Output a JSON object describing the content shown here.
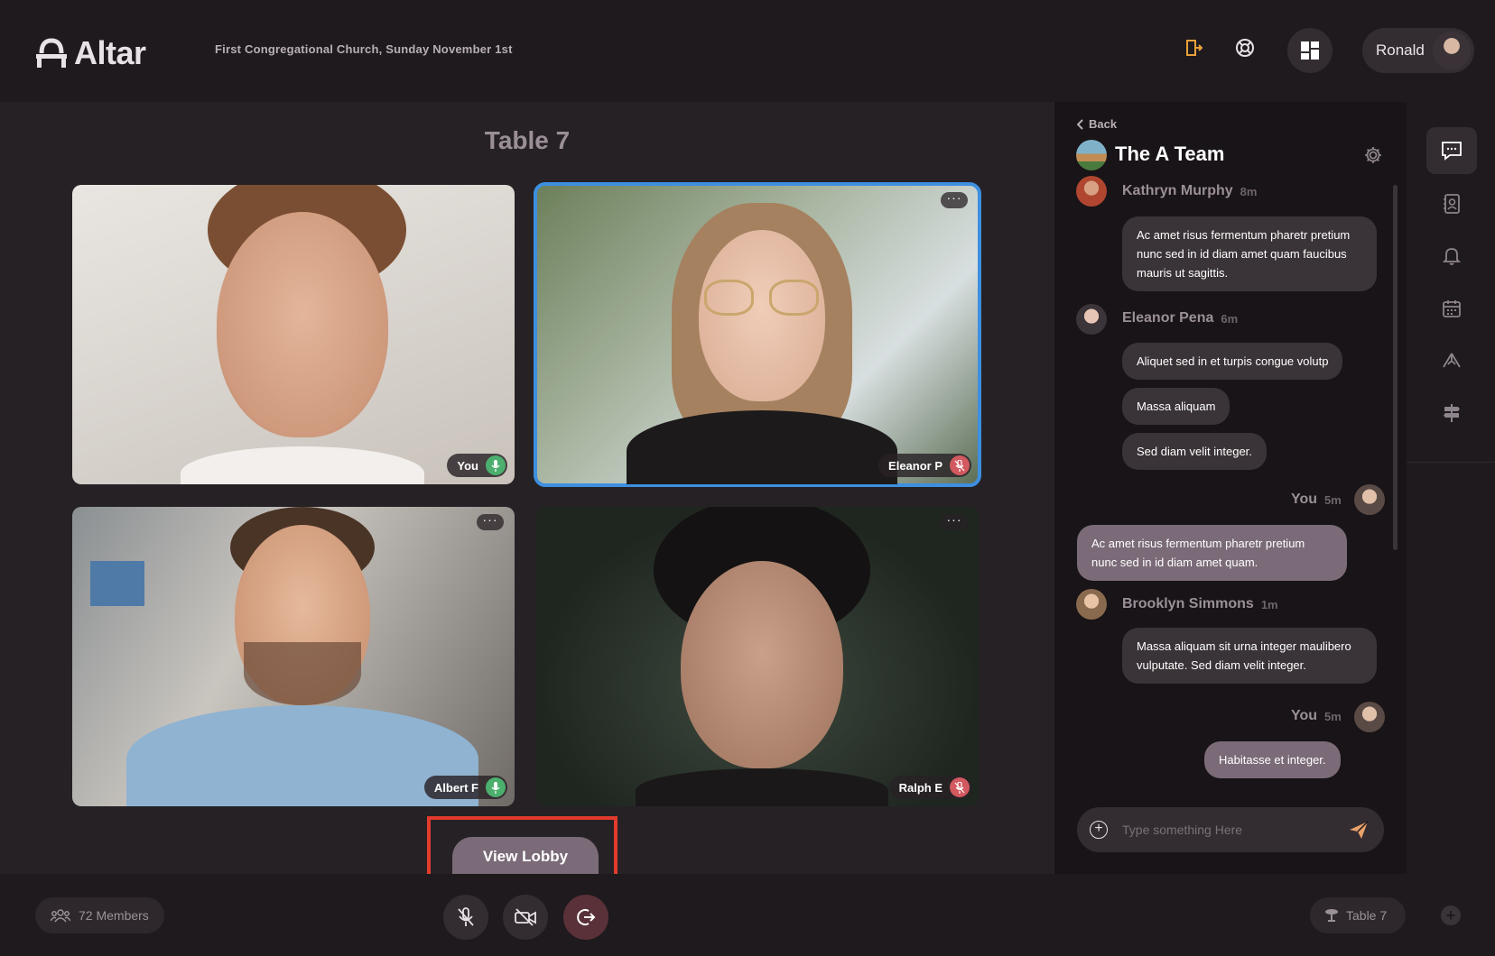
{
  "app": {
    "name": "Altar",
    "event_title": "First Congregational Church, Sunday November 1st"
  },
  "header": {
    "user_name": "Ronald",
    "icons": [
      "exit-door-icon",
      "lifebuoy-icon",
      "grid-layout-icon"
    ]
  },
  "stage": {
    "title": "Table 7",
    "participants": [
      {
        "name": "You",
        "mic": "on"
      },
      {
        "name": "Eleanor P",
        "mic": "off",
        "active": true
      },
      {
        "name": "Albert F",
        "mic": "on"
      },
      {
        "name": "Ralph E",
        "mic": "off"
      }
    ],
    "lobby_button": "View Lobby"
  },
  "chat": {
    "back_label": "Back",
    "team_name": "The A Team",
    "messages": [
      {
        "author": "Kathryn Murphy",
        "time": "8m",
        "texts": [
          "Ac amet risus fermentum pharetr pretium nunc sed in id diam amet quam faucibus mauris ut sagittis."
        ]
      },
      {
        "author": "Eleanor Pena",
        "time": "6m",
        "texts": [
          "Aliquet sed in et turpis congue volutp",
          "Massa aliquam",
          "Sed diam velit integer."
        ]
      },
      {
        "author": "You",
        "time": "5m",
        "texts": [
          "Ac amet risus fermentum pharetr pretium nunc sed in id diam amet quam."
        ]
      },
      {
        "author": "Brooklyn Simmons",
        "time": "1m",
        "texts": [
          "Massa aliquam sit urna integer maulibero vulputate. Sed diam velit integer."
        ]
      },
      {
        "author": "You",
        "time": "5m",
        "texts": [
          "Habitasse et integer."
        ]
      }
    ],
    "composer": {
      "placeholder": "Type something Here"
    }
  },
  "footer": {
    "members_label": "72 Members",
    "table_label": "Table 7"
  },
  "rail_icons": [
    "chat-icon",
    "contacts-icon",
    "bell-icon",
    "calendar-icon",
    "prayer-hands-icon",
    "signpost-icon"
  ],
  "colors": {
    "accent": "#7b6b78",
    "active_tile": "#3d8fe0",
    "mic_on": "#4caf6e",
    "mic_off": "#d2595f",
    "highlight": "#e23b2e"
  }
}
